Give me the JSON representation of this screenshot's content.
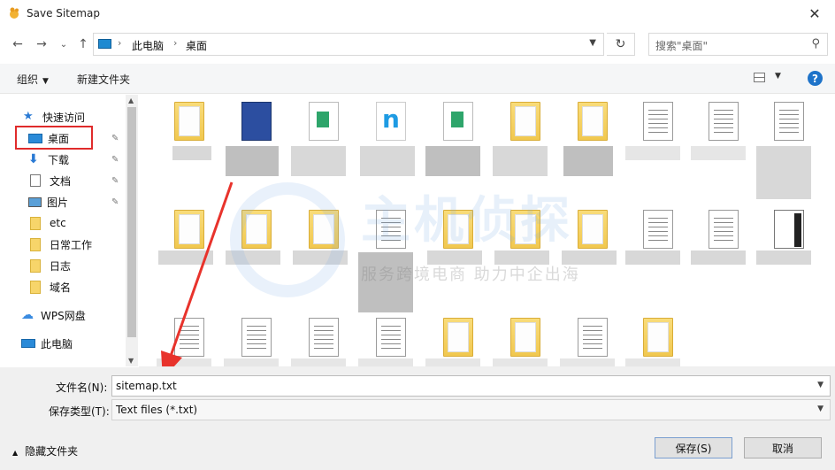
{
  "window": {
    "title": "Save Sitemap",
    "close_glyph": "✕"
  },
  "nav": {
    "back_glyph": "←",
    "forward_glyph": "→",
    "recent_glyph": "⌄",
    "up_glyph": "↑",
    "breadcrumb": [
      "此电脑",
      "桌面"
    ],
    "crumb_sep": "›",
    "refresh_glyph": "↻",
    "search_placeholder": "搜索\"桌面\""
  },
  "toolbar": {
    "organize": "组织",
    "new_folder": "新建文件夹",
    "help": "?"
  },
  "sidebar": {
    "items": [
      {
        "label": "快速访问",
        "icon": "star-icon"
      },
      {
        "label": "桌面",
        "icon": "desktop-icon",
        "pinned": true
      },
      {
        "label": "下载",
        "icon": "download-icon",
        "pinned": true
      },
      {
        "label": "文档",
        "icon": "document-icon",
        "pinned": true
      },
      {
        "label": "图片",
        "icon": "picture-icon",
        "pinned": true
      },
      {
        "label": "etc",
        "icon": "folder-icon"
      },
      {
        "label": "日常工作",
        "icon": "folder-icon"
      },
      {
        "label": "日志",
        "icon": "folder-icon"
      },
      {
        "label": "域名",
        "icon": "folder-icon"
      },
      {
        "label": "WPS网盘",
        "icon": "cloud-icon"
      },
      {
        "label": "此电脑",
        "icon": "computer-icon"
      }
    ],
    "pin_glyph": "📌"
  },
  "watermark": {
    "brand": "主机侦探",
    "slogan": "服务跨境电商 助力中企出海"
  },
  "form": {
    "filename_label": "文件名(N):",
    "filename_value": "sitemap.txt",
    "filetype_label": "保存类型(T):",
    "filetype_value": "Text files (*.txt)",
    "hide_folders": "隐藏文件夹",
    "save": "保存(S)",
    "cancel": "取消"
  },
  "colors": {
    "highlight": "#e02b2b",
    "accent": "#1e73c9",
    "arrow": "#e8332c"
  }
}
